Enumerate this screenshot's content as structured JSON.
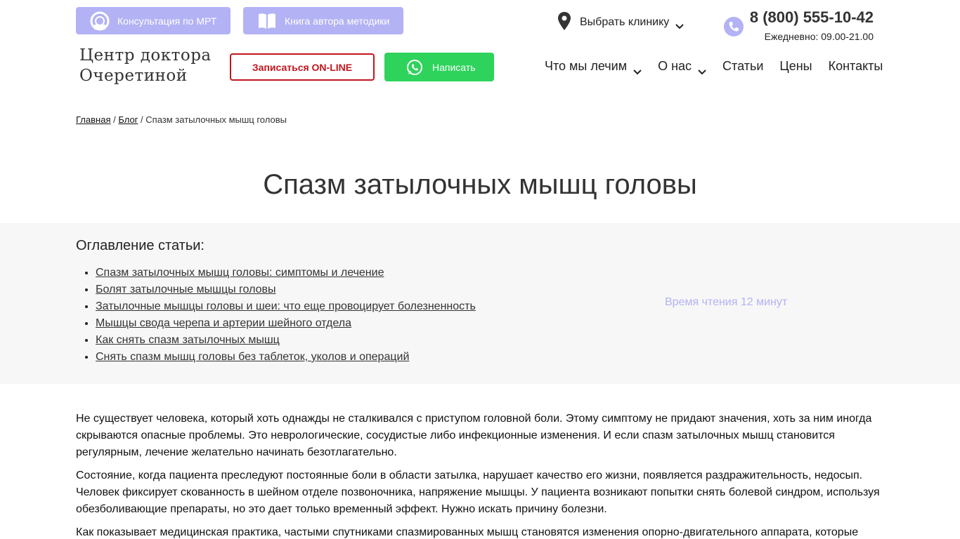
{
  "header": {
    "mrt_button": "Консультация по МРТ",
    "book_button": "Книга автора методики",
    "clinic_select": "Выбрать клинику",
    "phone": "8 (800) 555-10-42",
    "hours": "Ежедневно: 09.00-21.00",
    "logo_line1": "Центр доктора",
    "logo_line2": "Очеретиной",
    "online_button": "Записаться ON-LINE",
    "write_button": "Написать",
    "nav": {
      "treat": "Что мы лечим",
      "about": "О нас",
      "articles": "Статьи",
      "prices": "Цены",
      "contacts": "Контакты"
    }
  },
  "breadcrumb": {
    "home": "Главная",
    "sep1": " / ",
    "blog": "Блог",
    "sep2": " / ",
    "current": "Спазм затылочных мышц головы"
  },
  "page_title": "Спазм затылочных мышц головы",
  "toc": {
    "heading": "Оглавление статьи:",
    "items": [
      "Спазм затылочных мышц головы: симптомы и лечение",
      "Болят затылочные мышцы головы",
      "Затылочные мышцы головы и шеи: что еще провоцирует болезненность",
      "Мышцы свода черепа и артерии шейного отдела",
      "Как снять спазм затылочных мышц",
      "Снять спазм мышц головы без таблеток, уколов и операций"
    ],
    "read_time": "Время чтения 12 минут"
  },
  "article": {
    "paragraphs": [
      "Не существует человека, который хоть однажды не сталкивался с приступом головной боли. Этому симптому не придают значения, хоть за ним иногда скрываются опасные проблемы. Это неврологические, сосудистые либо инфекционные изменения. И если спазм затылочных мышц становится регулярным, лечение желательно начинать безотлагательно.",
      "Состояние, когда пациента преследуют постоянные боли в области затылка, нарушает качество его жизни, появляется раздражительность, недосып. Человек фиксирует скованность в шейном отделе позвоночника, напряжение мышцы. У пациента возникают попытки снять болевой синдром, используя обезболивающие препараты, но это дает только временный эффект. Нужно искать причину болезни.",
      "Как показывает медицинская практика, частыми спутниками спазмированных мышц становятся изменения опорно-двигательного аппарата, которые"
    ]
  },
  "colors": {
    "accent_lilac": "#b3b2f5",
    "online_red": "#c0161d",
    "whatsapp_green": "#2ed35b",
    "toc_bg": "#f7f7f7"
  },
  "icons": [
    "mri-scanner-icon",
    "book-icon",
    "map-pin-icon",
    "chevron-down-icon",
    "phone-icon",
    "whatsapp-icon"
  ]
}
